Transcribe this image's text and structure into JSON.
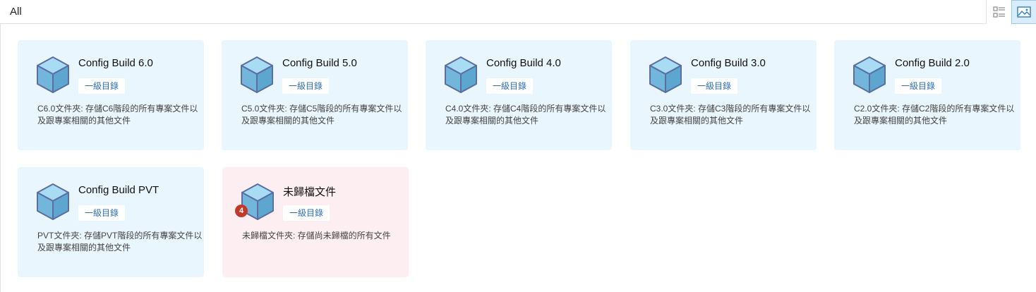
{
  "header": {
    "title": "All",
    "list_view_icon": "list-view-icon",
    "grid_view_icon": "image-grid-icon"
  },
  "colors": {
    "card_blue": "#eaf6fd",
    "card_pink": "#fdeef2",
    "tag_text": "#2f6fb0",
    "badge": "#c0392b",
    "cube_front": "#72b6dc",
    "cube_top": "#a7dcf4"
  },
  "cards": [
    {
      "title": "Config Build 6.0",
      "tag": "一級目錄",
      "desc": "C6.0文件夾: 存儲C6階段的所有專案文件以及跟專案相關的其他文件",
      "icon": "cube-icon"
    },
    {
      "title": "Config Build 5.0",
      "tag": "一級目錄",
      "desc": "C5.0文件夾: 存儲C5階段的所有專案文件以及跟專案相關的其他文件",
      "icon": "cube-icon"
    },
    {
      "title": "Config Build 4.0",
      "tag": "一級目錄",
      "desc": "C4.0文件夾: 存儲C4階段的所有專案文件以及跟專案相關的其他文件",
      "icon": "cube-icon"
    },
    {
      "title": "Config Build 3.0",
      "tag": "一級目錄",
      "desc": "C3.0文件夾: 存儲C3階段的所有專案文件以及跟專案相關的其他文件",
      "icon": "cube-icon"
    },
    {
      "title": "Config Build 2.0",
      "tag": "一級目錄",
      "desc": "C2.0文件夾: 存儲C2階段的所有專案文件以及跟專案相關的其他文件",
      "icon": "cube-icon"
    },
    {
      "title": "Config Build PVT",
      "tag": "一級目錄",
      "desc": "PVT文件夾: 存儲PVT階段的所有專案文件以及跟專案相關的其他文件",
      "icon": "cube-icon"
    },
    {
      "title": "未歸檔文件",
      "tag": "一級目錄",
      "desc": "未歸檔文件夾: 存儲尚未歸檔的所有文件",
      "icon": "cube-icon",
      "badge": "4"
    }
  ]
}
